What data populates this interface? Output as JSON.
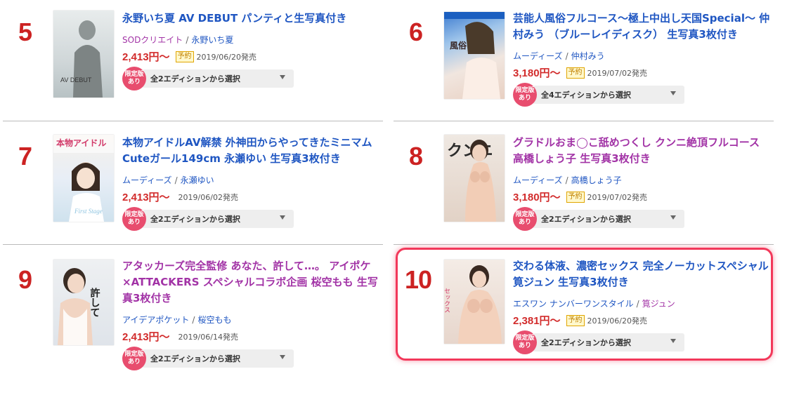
{
  "items": [
    {
      "rank": "5",
      "title": "永野いち夏 AV DEBUT パンティと生写真付き",
      "maker": "SODクリエイト",
      "actress": "永野いち夏",
      "price": "2,413円〜",
      "badge": "予約",
      "date": "2019/06/20発売",
      "limited_line1": "限定版",
      "limited_line2": "あり",
      "edition": "全2エディションから選択",
      "cover_text": "AV DEBUT"
    },
    {
      "rank": "6",
      "title": "芸能人風俗フルコース〜極上中出し天国Special〜 仲村みう （ブルーレイディスク） 生写真3枚付き",
      "maker": "ムーディーズ",
      "actress": "仲村みう",
      "price": "3,180円〜",
      "badge": "予約",
      "date": "2019/07/02発売",
      "limited_line1": "限定版",
      "limited_line2": "あり",
      "edition": "全4エディションから選択",
      "cover_text": "風俗"
    },
    {
      "rank": "7",
      "title": "本物アイドルAV解禁 外神田からやってきたミニマムCuteガール149cm 永瀬ゆい 生写真3枚付き",
      "maker": "ムーディーズ",
      "actress": "永瀬ゆい",
      "price": "2,413円〜",
      "badge": "",
      "date": "2019/06/02発売",
      "limited_line1": "限定版",
      "limited_line2": "あり",
      "edition": "全2エディションから選択",
      "cover_text": "本物アイドル"
    },
    {
      "rank": "8",
      "title": "グラドルおま◯こ舐めつくし クンニ絶頂フルコース 高橋しょう子 生写真3枚付き",
      "maker": "ムーディーズ",
      "actress": "高橋しょう子",
      "price": "3,180円〜",
      "badge": "予約",
      "date": "2019/07/02発売",
      "limited_line1": "限定版",
      "limited_line2": "あり",
      "edition": "全2エディションから選択",
      "cover_text": "クンニ"
    },
    {
      "rank": "9",
      "title": "アタッカーズ完全監修 あなた、許して…。 アイポケ×ATTACKERS スペシャルコラボ企画 桜空もも 生写真3枚付き",
      "maker": "アイデアポケット",
      "actress": "桜空もも",
      "price": "2,413円〜",
      "badge": "",
      "date": "2019/06/14発売",
      "limited_line1": "限定版",
      "limited_line2": "あり",
      "edition": "全2エディションから選択",
      "cover_text": "許して"
    },
    {
      "rank": "10",
      "title": "交わる体液、濃密セックス 完全ノーカットスペシャル 筧ジュン 生写真3枚付き",
      "maker": "エスワン ナンバーワンスタイル",
      "actress": "筧ジュン",
      "price": "2,381円〜",
      "badge": "予約",
      "date": "2019/06/20発売",
      "limited_line1": "限定版",
      "limited_line2": "あり",
      "edition": "全2エディションから選択",
      "cover_text": "セックス"
    }
  ],
  "colors": {
    "rank": "#cc2222",
    "title_blue": "#1f56c2",
    "title_purple": "#a233a6",
    "price": "#d22b2b",
    "limited": "#e84d6e",
    "highlight": "#f2385a"
  }
}
